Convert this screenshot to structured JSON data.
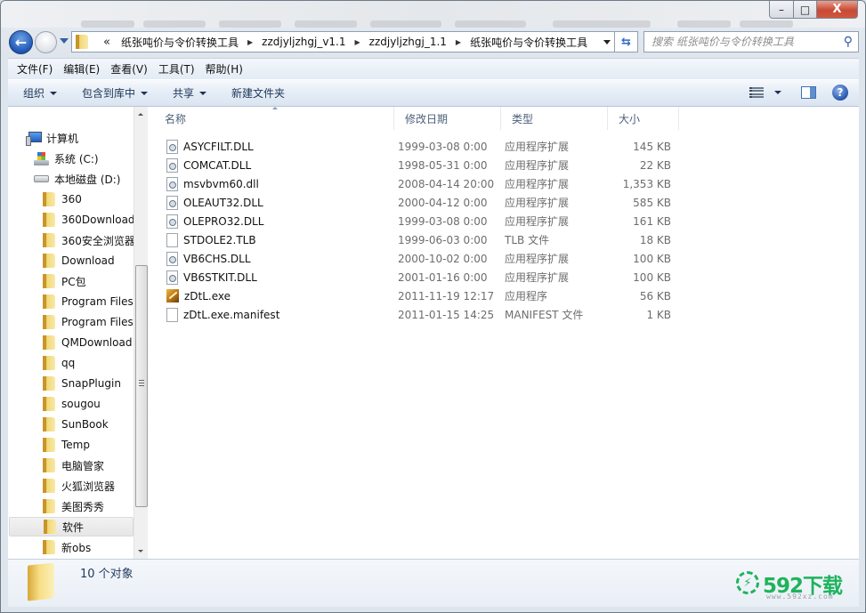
{
  "window": {
    "caption": {
      "minimize": "–",
      "maximize": "□",
      "close": "X"
    }
  },
  "nav": {
    "back_icon": "←",
    "breadcrumb_overflow": "«",
    "breadcrumbs": [
      "纸张吨价与令价转换工具",
      "zzdjyljzhgj_v1.1",
      "zzdjyljzhgj_1.1",
      "纸张吨价与令价转换工具"
    ],
    "refresh_icon": "⇆",
    "search_placeholder": "搜索 纸张吨价与令价转换工具",
    "search_icon": "⚲"
  },
  "menu": [
    "文件(F)",
    "编辑(E)",
    "查看(V)",
    "工具(T)",
    "帮助(H)"
  ],
  "commands": {
    "organize": "组织",
    "include_in_library": "包含到库中",
    "share": "共享",
    "new_folder": "新建文件夹",
    "help_icon": "?"
  },
  "tree": {
    "computer": "计算机",
    "drives": [
      {
        "label": "系统 (C:)",
        "icon": "system-drive-icon"
      },
      {
        "label": "本地磁盘 (D:)",
        "icon": "local-drive-icon"
      }
    ],
    "folders": [
      "360",
      "360Download",
      "360安全浏览器",
      "Download",
      "PC包",
      "Program Files",
      "Program Files",
      "QMDownload",
      "qq",
      "SnapPlugin",
      "sougou",
      "SunBook",
      "Temp",
      "电脑管家",
      "火狐浏览器",
      "美图秀秀",
      "软件",
      "新obs"
    ],
    "selected": "软件"
  },
  "columns": {
    "name": "名称",
    "date": "修改日期",
    "type": "类型",
    "size": "大小"
  },
  "files": [
    {
      "name": "ASYCFILT.DLL",
      "date": "1999-03-08 0:00",
      "type": "应用程序扩展",
      "size": "145 KB",
      "icon": "dll"
    },
    {
      "name": "COMCAT.DLL",
      "date": "1998-05-31 0:00",
      "type": "应用程序扩展",
      "size": "22 KB",
      "icon": "dll"
    },
    {
      "name": "msvbvm60.dll",
      "date": "2008-04-14 20:00",
      "type": "应用程序扩展",
      "size": "1,353 KB",
      "icon": "dll"
    },
    {
      "name": "OLEAUT32.DLL",
      "date": "2000-04-12 0:00",
      "type": "应用程序扩展",
      "size": "585 KB",
      "icon": "dll"
    },
    {
      "name": "OLEPRO32.DLL",
      "date": "1999-03-08 0:00",
      "type": "应用程序扩展",
      "size": "161 KB",
      "icon": "dll"
    },
    {
      "name": "STDOLE2.TLB",
      "date": "1999-06-03 0:00",
      "type": "TLB 文件",
      "size": "18 KB",
      "icon": "doc"
    },
    {
      "name": "VB6CHS.DLL",
      "date": "2000-10-02 0:00",
      "type": "应用程序扩展",
      "size": "100 KB",
      "icon": "dll"
    },
    {
      "name": "VB6STKIT.DLL",
      "date": "2001-01-16 0:00",
      "type": "应用程序扩展",
      "size": "100 KB",
      "icon": "dll"
    },
    {
      "name": "zDtL.exe",
      "date": "2011-11-19 12:17",
      "type": "应用程序",
      "size": "56 KB",
      "icon": "exe"
    },
    {
      "name": "zDtL.exe.manifest",
      "date": "2011-01-15 14:25",
      "type": "MANIFEST 文件",
      "size": "1 KB",
      "icon": "doc"
    }
  ],
  "status": {
    "count": "10 个对象"
  },
  "watermark": {
    "brand": "592下载",
    "url": "www.592xz.com",
    "icon": "⚡",
    "color": "#1fb35c"
  }
}
